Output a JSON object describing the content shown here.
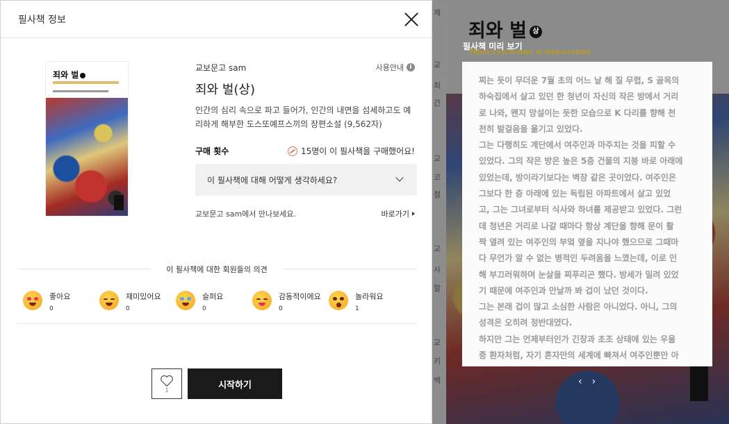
{
  "modal": {
    "title": "필사책 정보",
    "cover": {
      "title": "죄와 벌"
    },
    "publisher": "교보문고 sam",
    "guide_label": "사용안내",
    "book_title": "죄와 벌(상)",
    "description": "인간의 심리 속으로 파고 들어가, 인간의 내면을 섬세하고도 예리하게 해부한 도스또예프스끼의 장편소설 (9,562자)",
    "purchase": {
      "label": "구매 횟수",
      "count_text": "15명이 이 필사책을 구매했어요!"
    },
    "opinion_placeholder": "이 필사책에 대해 어떻게 생각하세요?",
    "meet_text": "교보문고 sam에서 만나보세요.",
    "goto_label": "바로가기",
    "section_title": "이 필사책에 대한 회원들의 의견",
    "reactions": [
      {
        "label": "좋아요",
        "count": "0"
      },
      {
        "label": "재미있어요",
        "count": "0"
      },
      {
        "label": "슬퍼요",
        "count": "0"
      },
      {
        "label": "감동적이에요",
        "count": "0"
      },
      {
        "label": "놀라워요",
        "count": "1"
      }
    ],
    "like_count": "1",
    "start_label": "시작하기"
  },
  "preview": {
    "book_title": "죄와 벌",
    "volume_badge": "상",
    "heading": "필사책 미리 보기",
    "russian_title": "Преступление и наказание",
    "lines": [
      "찌는 듯이 무더운 7월 초의 어느 날 해 질 무렵, S 골목의",
      "하숙집에서 살고 있던 한 청년이 자신의 작은 방에서 거리",
      "로 나와, 왠지 망설이는 듯한 모습으로 K 다리를 향해 천",
      "천히 발걸음을 옮기고 있었다.",
      "그는 다행히도 계단에서 여주인과 마주치는 것을 피할 수",
      "있었다. 그의 작은 방은 높은 5층 건물의 지붕 바로 아래에",
      "있었는데, 방이라기보다는 벽장 같은 곳이었다. 여주인은",
      "그보다 한 층 아래에 있는 독립된 아파트에서 살고 있었",
      "고, 그는 그녀로부터 식사와 하녀를 제공받고 있었다. 그런",
      "데 청년은 거리로 나갈 때마다 항상 계단을 향해 문이 활",
      "짝 열려 있는 여주인의 부엌 옆을 지나야 했으므로 그때마",
      "다 무언가 알 수 없는 병적인 두려움을 느꼈는데, 이로 인",
      "해 부끄러워하며 눈살을 찌푸리곤 했다. 방세가 밀려 있었",
      "기 때문에 여주인과 만날까 봐 겁이 났던 것이다.",
      "그는 본래 겁이 많고 소심한 사람은 아니었다. 아니, 그의",
      "성격은 오히려 정반대였다.",
      "하지만 그는 언제부터인가 긴장과 초조 상태에 있는 우울",
      "증 환자처럼, 자기 혼자만의 세계에 빠져서 여주인뿐만 아"
    ],
    "prev": "‹",
    "next": "›"
  },
  "background_fragments": [
    "제",
    "교",
    "죄",
    "간",
    "교",
    "코",
    "절",
    "교",
    "사",
    "할",
    "교",
    "키",
    "백"
  ]
}
